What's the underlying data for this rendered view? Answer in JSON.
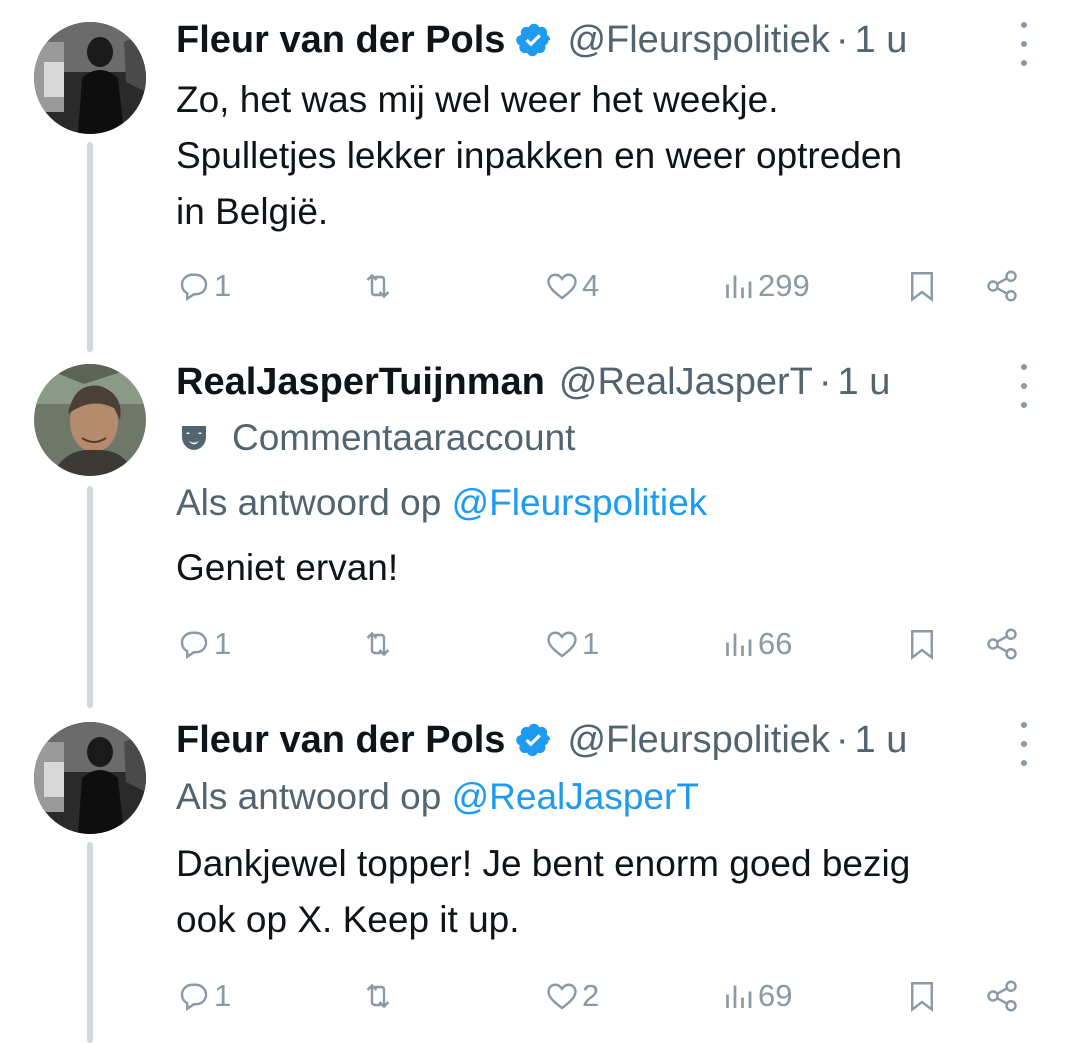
{
  "colors": {
    "accent": "#1d9bf0",
    "verified": "#1d9bf0",
    "text": "#0f1419",
    "muted": "#536471",
    "icon": "#8b98a5",
    "thread_line": "#cfd9de"
  },
  "tweets": [
    {
      "name": "Fleur van der Pols",
      "verified": true,
      "handle": "@Fleurspolitiek",
      "separator": "·",
      "time": "1 u",
      "lines": [
        "Zo, het was mij wel weer het weekje.",
        "Spulletjes lekker inpakken en weer  optreden",
        "in België."
      ],
      "stats": {
        "replies": "1",
        "retweets": "",
        "likes": "4",
        "views": "299"
      }
    },
    {
      "name": "RealJasperTuijnman",
      "verified": false,
      "handle": "@RealJasperT",
      "separator": "·",
      "time": "1 u",
      "label_icon": "theater-mask-icon",
      "label": "Commentaaraccount",
      "reply_prefix": "Als antwoord op",
      "reply_to": "@Fleurspolitiek",
      "lines": [
        "Geniet ervan!"
      ],
      "stats": {
        "replies": "1",
        "retweets": "",
        "likes": "1",
        "views": "66"
      }
    },
    {
      "name": "Fleur van der Pols",
      "verified": true,
      "handle": "@Fleurspolitiek",
      "separator": "·",
      "time": "1 u",
      "reply_prefix": "Als antwoord op",
      "reply_to": "@RealJasperT",
      "lines": [
        "Dankjewel topper! Je bent enorm goed bezig",
        "ook op X. Keep it up."
      ],
      "stats": {
        "replies": "1",
        "retweets": "",
        "likes": "2",
        "views": "69"
      }
    }
  ],
  "icons": [
    "reply-icon",
    "retweet-icon",
    "like-icon",
    "views-icon",
    "bookmark-icon",
    "share-icon",
    "more-icon",
    "verified-icon"
  ]
}
